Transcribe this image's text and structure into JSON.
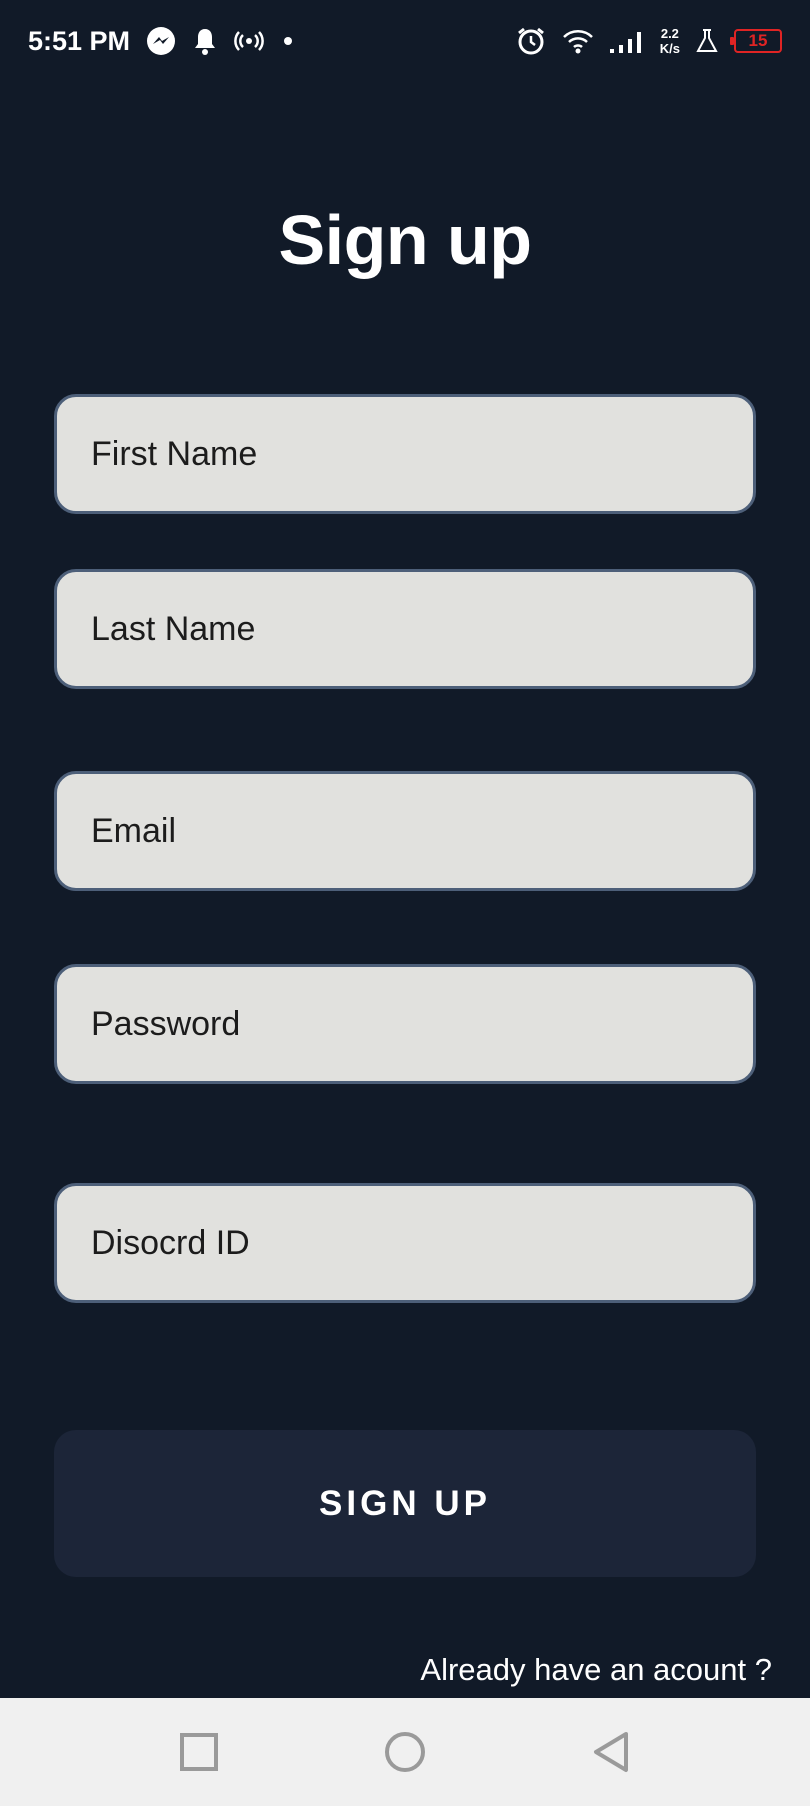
{
  "status_bar": {
    "time": "5:51 PM",
    "net_speed_value": "2.2",
    "net_speed_unit": "K/s",
    "battery": "15"
  },
  "page": {
    "title": "Sign up"
  },
  "form": {
    "first_name_placeholder": "First Name",
    "last_name_placeholder": "Last Name",
    "email_placeholder": "Email",
    "password_placeholder": "Password",
    "discord_placeholder": "Disocrd ID",
    "submit_label": "SIGN UP",
    "login_link": "Already have an acount ?"
  },
  "icons": {
    "status": [
      "messenger-icon",
      "bell-icon",
      "hotspot-icon",
      "dot-icon",
      "alarm-icon",
      "wifi-icon",
      "signal-icon",
      "flask-icon",
      "battery-icon"
    ],
    "nav": [
      "recents-square-icon",
      "home-circle-icon",
      "back-triangle-icon"
    ]
  },
  "colors": {
    "background": "#111a28",
    "field_bg": "#e1e1de",
    "field_border": "#4d5f79",
    "button_bg": "#1c2538",
    "battery_low": "#e02424",
    "nav_bar": "#f0f0f0"
  }
}
